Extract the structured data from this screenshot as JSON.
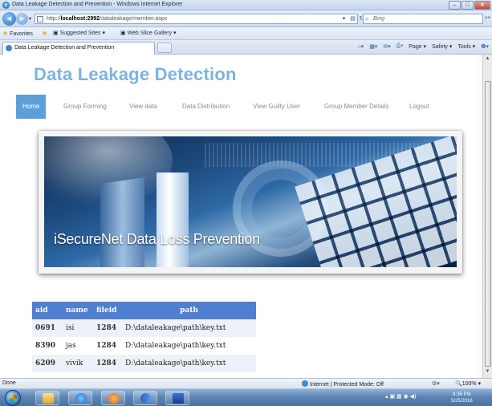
{
  "window": {
    "title": "Data Leakage Detection and Prevention - Windows Internet Explorer",
    "minimize": "–",
    "maximize": "□",
    "close": "✕"
  },
  "addressbar": {
    "url_prefix": "http://",
    "url_host": "localhost:2992",
    "url_path": "/dataleakage/member.aspx",
    "search_placeholder": "Bing"
  },
  "favorites": {
    "label": "Favorites",
    "items": [
      "Suggested Sites ▾",
      "Web Slice Gallery ▾"
    ]
  },
  "tab": {
    "label": "Data Leakage Detection and Prevention"
  },
  "commandbar": {
    "page": "Page ▾",
    "safety": "Safety ▾",
    "tools": "Tools ▾",
    "help": "❷▾"
  },
  "site": {
    "title": "Data Leakage Detection",
    "nav": [
      "Home",
      "Group Forming",
      "View data",
      "Data Distribution",
      "View Guilty User",
      "Group Member Details",
      "Logout"
    ],
    "active_nav": "Home",
    "banner_tagline": "iSecureNet Data Loss Prevention"
  },
  "table": {
    "headers": [
      "aid",
      "name",
      "fileid",
      "path"
    ],
    "rows": [
      [
        "0691",
        "isi",
        "1284",
        "D:\\dataleakage\\path\\key.txt"
      ],
      [
        "8390",
        "jas",
        "1284",
        "D:\\dataleakage\\path\\key.txt"
      ],
      [
        "6209",
        "vivik",
        "1284",
        "D:\\dataleakage\\path\\key.txt"
      ]
    ]
  },
  "status": {
    "left": "Done",
    "zone": "Internet | Protected Mode: Off",
    "zoom": "100% ▾"
  },
  "taskbar": {
    "time": "8:36 PM",
    "date": "5/25/2016"
  },
  "colors": {
    "accent": "#5f9fd9",
    "title": "#7bb4e3",
    "table_header": "#4f7fcf"
  }
}
